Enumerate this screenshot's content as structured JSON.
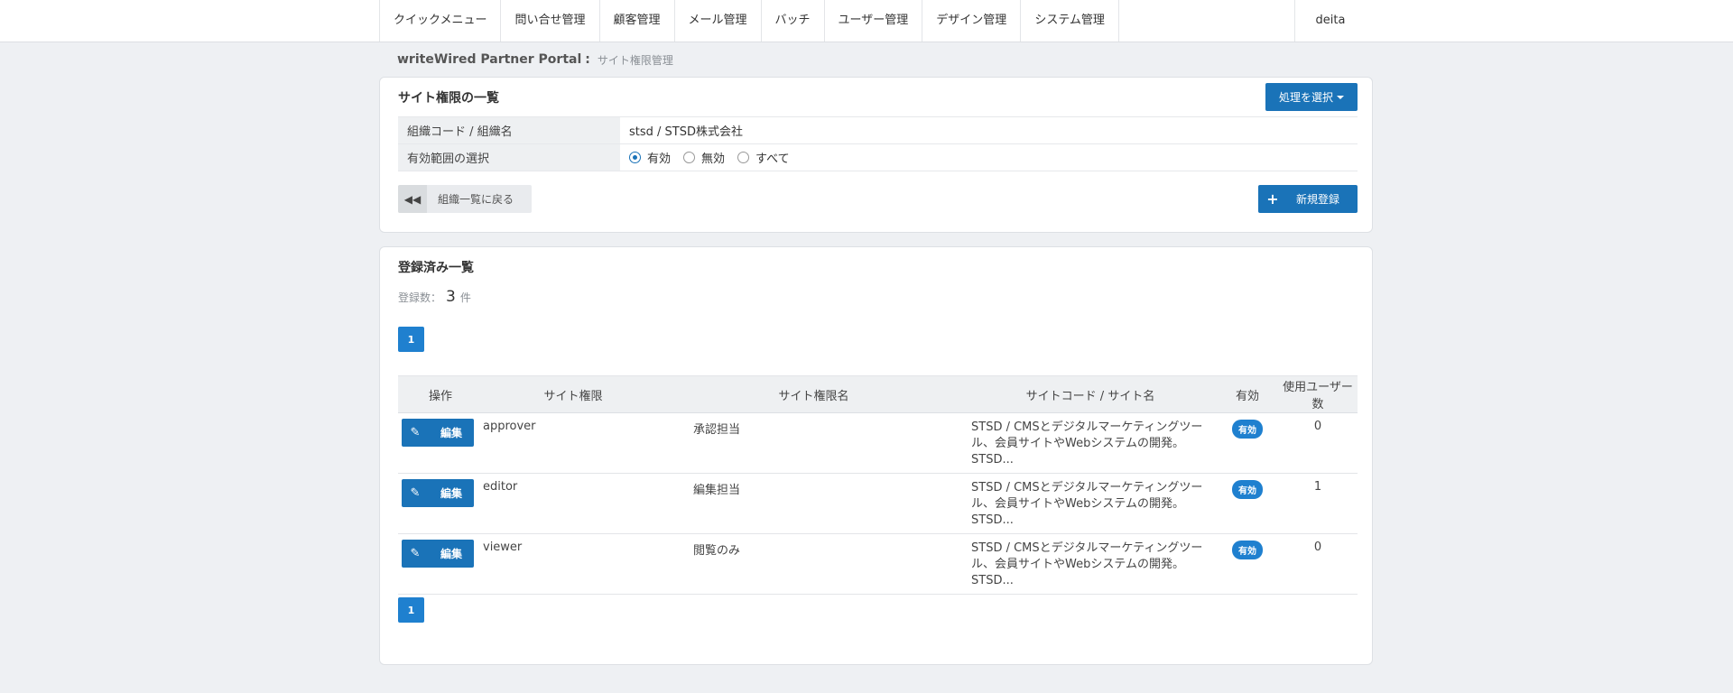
{
  "nav": {
    "items": [
      "クイックメニュー",
      "問い合せ管理",
      "顧客管理",
      "メール管理",
      "バッチ",
      "ユーザー管理",
      "デザイン管理",
      "システム管理"
    ],
    "user": "deita"
  },
  "breadcrumb": {
    "portal": "writeWired Partner Portal",
    "separator": ":",
    "current": "サイト権限管理"
  },
  "permissions_panel": {
    "title": "サイト権限の一覧",
    "action_button": "処理を選択",
    "org_label": "組織コード / 組織名",
    "org_value": "stsd / STSD株式会社",
    "range_label": "有効範囲の選択",
    "range_options": [
      "有効",
      "無効",
      "すべて"
    ],
    "range_selected": "有効",
    "back_button": "組織一覧に戻る",
    "new_button": "新規登録"
  },
  "list_panel": {
    "title": "登録済み一覧",
    "count_label": "登録数：",
    "count_value": "3",
    "count_unit": "件",
    "page": "1",
    "columns": [
      "操作",
      "サイト権限",
      "サイト権限名",
      "サイトコード / サイト名",
      "有効",
      "使用ユーザー数"
    ],
    "edit_label": "編集",
    "rows": [
      {
        "perm": "approver",
        "name": "承認担当",
        "site": "STSD / CMSとデジタルマーケティングツール、会員サイトやWebシステムの開発。STSD...",
        "status": "有効",
        "users": "0"
      },
      {
        "perm": "editor",
        "name": "編集担当",
        "site": "STSD / CMSとデジタルマーケティングツール、会員サイトやWebシステムの開発。STSD...",
        "status": "有効",
        "users": "1"
      },
      {
        "perm": "viewer",
        "name": "閲覧のみ",
        "site": "STSD / CMSとデジタルマーケティングツール、会員サイトやWebシステムの開発。STSD...",
        "status": "有効",
        "users": "0"
      }
    ]
  },
  "colors": {
    "primary": "#1a73b8",
    "badge": "#1f80cf",
    "background": "#eef0f3"
  },
  "icons": {
    "back": "double-chevron-left-icon",
    "new": "plus-icon",
    "edit": "pencil-icon",
    "dropdown": "caret-down-icon"
  }
}
